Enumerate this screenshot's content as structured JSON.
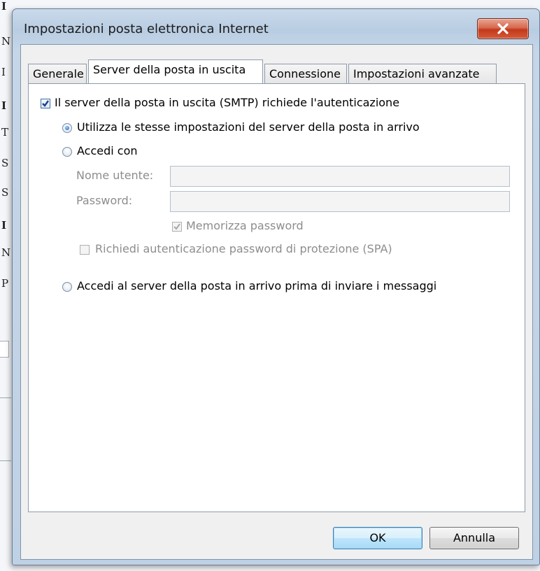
{
  "background_window": {
    "letters": [
      {
        "text": "I",
        "bold": true
      },
      {
        "text": "N",
        "bold": false
      },
      {
        "text": "I",
        "bold": false
      },
      {
        "text": "I",
        "bold": true
      },
      {
        "text": "T",
        "bold": false
      },
      {
        "text": "S",
        "bold": false
      },
      {
        "text": "S",
        "bold": false
      },
      {
        "text": "I",
        "bold": true
      },
      {
        "text": "N",
        "bold": false
      },
      {
        "text": "P",
        "bold": false
      }
    ]
  },
  "dialog": {
    "title": "Impostazioni posta elettronica Internet",
    "tabs": [
      {
        "label": "Generale",
        "active": false
      },
      {
        "label": "Server della posta in uscita",
        "active": true
      },
      {
        "label": "Connessione",
        "active": false
      },
      {
        "label": "Impostazioni avanzate",
        "active": false
      }
    ],
    "smtp_auth": {
      "label": "Il server della posta in uscita (SMTP) richiede l'autenticazione",
      "checked": true
    },
    "use_same_settings": {
      "label": "Utilizza le stesse impostazioni del server della posta in arrivo",
      "checked": true
    },
    "login_with": {
      "label": "Accedi con",
      "checked": false,
      "username_label": "Nome utente:",
      "username_value": "",
      "password_label": "Password:",
      "password_value": "",
      "remember_password_label": "Memorizza password",
      "remember_password_checked": true,
      "spa_label": "Richiedi autenticazione password di protezione (SPA)",
      "spa_checked": false
    },
    "login_incoming_first": {
      "label": "Accedi al server della posta in arrivo prima di inviare i messaggi",
      "checked": false
    },
    "ok_label": "OK",
    "cancel_label": "Annulla"
  },
  "colors": {
    "frame": "#bfd1e4",
    "close_button": "#c3391c",
    "accent": "#1b62b3",
    "disabled_text": "#8d8d8d"
  },
  "icons": [
    "close-icon",
    "arrow-cursor-icon",
    "checkmark-icon"
  ]
}
